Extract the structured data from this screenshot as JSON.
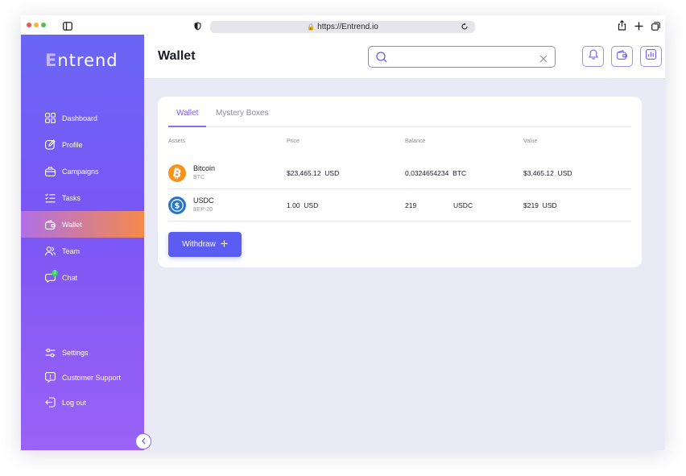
{
  "browser": {
    "url": "https://Entrend.io"
  },
  "brand": {
    "first_letter": "E",
    "rest": "ntrend"
  },
  "sidebar": {
    "items": [
      {
        "label": "Dashboard",
        "icon": "dashboard-icon"
      },
      {
        "label": "Profile",
        "icon": "edit-icon"
      },
      {
        "label": "Campaigns",
        "icon": "briefcase-icon"
      },
      {
        "label": "Tasks",
        "icon": "tasks-icon"
      },
      {
        "label": "Wallet",
        "icon": "wallet-icon",
        "active": true
      },
      {
        "label": "Team",
        "icon": "team-icon"
      },
      {
        "label": "Chat",
        "icon": "chat-icon",
        "badge": "2"
      }
    ],
    "lower_items": [
      {
        "label": "Settings",
        "icon": "settings-icon"
      },
      {
        "label": "Customer Support",
        "icon": "support-icon"
      },
      {
        "label": "Log out",
        "icon": "logout-icon"
      }
    ]
  },
  "header": {
    "title": "Wallet",
    "search_placeholder": "",
    "search_value": ""
  },
  "wallet": {
    "tabs": [
      {
        "label": "Wallet",
        "active": true
      },
      {
        "label": "Mystery Boxes",
        "active": false
      }
    ],
    "columns": [
      "Assets",
      "Price",
      "Balance",
      "Value"
    ],
    "rows": [
      {
        "name": "Bitcoin",
        "symbol": "BTC",
        "price": "$23,465.12",
        "price_unit": "USD",
        "balance": "0,0324654234",
        "balance_unit": "BTC",
        "value": "$3,465.12",
        "value_unit": "USD"
      },
      {
        "name": "USDC",
        "symbol": "BEP-20",
        "price": "1.00",
        "price_unit": "USD",
        "balance": "219",
        "balance_unit": "USDC",
        "value": "$219",
        "value_unit": "USD"
      }
    ],
    "withdraw_label": "Withdraw"
  },
  "colors": {
    "accent": "#5a5cf2",
    "sidebar_top": "#6a66f5",
    "sidebar_bottom": "#9b62f6",
    "active_start": "#b06fe8",
    "active_end": "#f48a4a",
    "bitcoin": "#f7931a",
    "usdc": "#2775ca",
    "badge": "#35d061"
  }
}
